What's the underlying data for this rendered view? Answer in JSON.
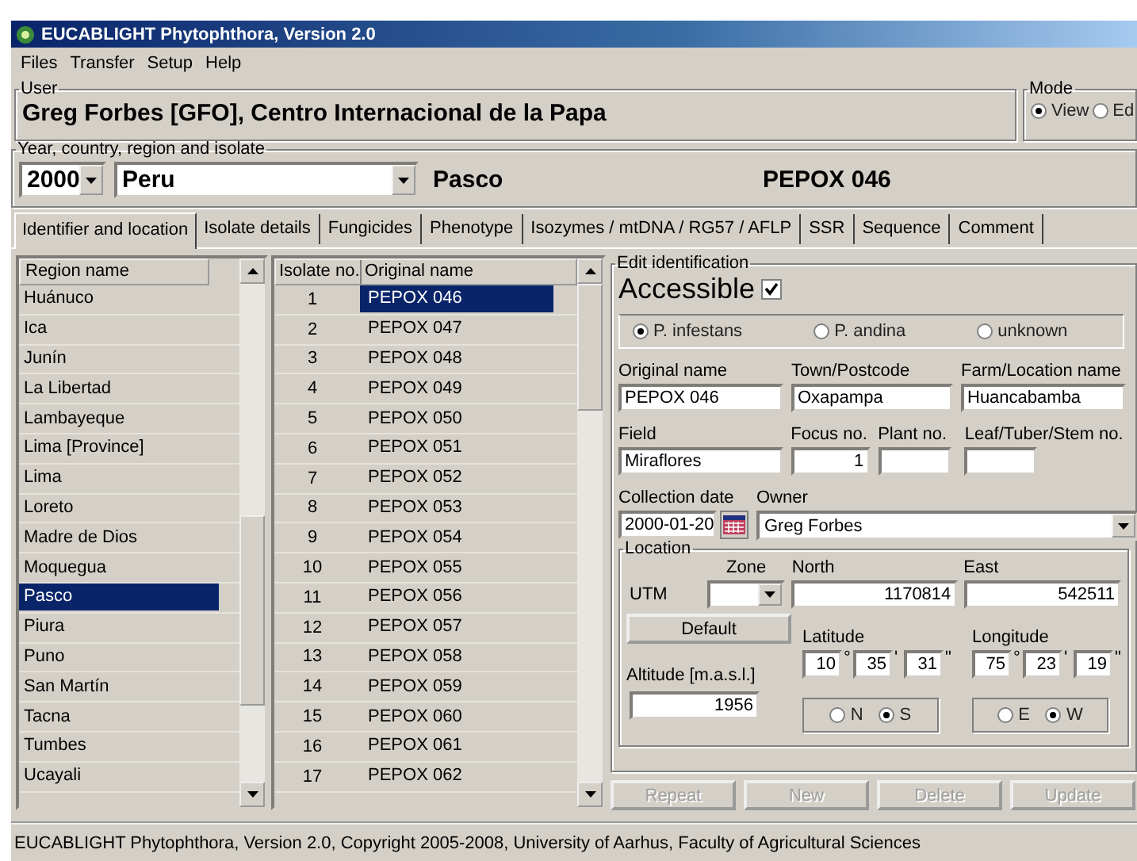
{
  "window": {
    "title": "EUCABLIGHT Phytophthora, Version 2.0"
  },
  "menu": [
    "Files",
    "Transfer",
    "Setup",
    "Help"
  ],
  "user": {
    "label": "User",
    "name": "Greg  Forbes [GFO], Centro Internacional de la Papa"
  },
  "mode": {
    "label": "Mode",
    "options": [
      {
        "label": "View",
        "selected": true
      },
      {
        "label": "Ed",
        "selected": false
      }
    ]
  },
  "selection": {
    "label": "Year, country, region and isolate",
    "year": "2000",
    "country": "Peru",
    "region": "Pasco",
    "isolate": "PEPOX 046"
  },
  "tabs": [
    {
      "label": "Identifier and location",
      "selected": true
    },
    {
      "label": "Isolate details",
      "selected": false
    },
    {
      "label": "Fungicides",
      "selected": false
    },
    {
      "label": "Phenotype",
      "selected": false
    },
    {
      "label": "Isozymes / mtDNA / RG57 / AFLP",
      "selected": false
    },
    {
      "label": "SSR",
      "selected": false
    },
    {
      "label": "Sequence",
      "selected": false
    },
    {
      "label": "Comment",
      "selected": false
    }
  ],
  "regions": {
    "column": "Region name",
    "items": [
      {
        "name": "Huánuco",
        "selected": false
      },
      {
        "name": "Ica",
        "selected": false
      },
      {
        "name": "Junín",
        "selected": false
      },
      {
        "name": "La Libertad",
        "selected": false
      },
      {
        "name": "Lambayeque",
        "selected": false
      },
      {
        "name": "Lima [Province]",
        "selected": false
      },
      {
        "name": "Lima",
        "selected": false
      },
      {
        "name": "Loreto",
        "selected": false
      },
      {
        "name": "Madre de Dios",
        "selected": false
      },
      {
        "name": "Moquegua",
        "selected": false
      },
      {
        "name": "Pasco",
        "selected": true
      },
      {
        "name": "Piura",
        "selected": false
      },
      {
        "name": "Puno",
        "selected": false
      },
      {
        "name": "San Martín",
        "selected": false
      },
      {
        "name": "Tacna",
        "selected": false
      },
      {
        "name": "Tumbes",
        "selected": false
      },
      {
        "name": "Ucayali",
        "selected": false
      }
    ]
  },
  "isolates": {
    "columns": [
      "Isolate no.",
      "Original name"
    ],
    "rows": [
      {
        "no": "1",
        "name": "PEPOX 046",
        "selected": true
      },
      {
        "no": "2",
        "name": "PEPOX 047",
        "selected": false
      },
      {
        "no": "3",
        "name": "PEPOX 048",
        "selected": false
      },
      {
        "no": "4",
        "name": "PEPOX 049",
        "selected": false
      },
      {
        "no": "5",
        "name": "PEPOX 050",
        "selected": false
      },
      {
        "no": "6",
        "name": "PEPOX 051",
        "selected": false
      },
      {
        "no": "7",
        "name": "PEPOX 052",
        "selected": false
      },
      {
        "no": "8",
        "name": "PEPOX 053",
        "selected": false
      },
      {
        "no": "9",
        "name": "PEPOX 054",
        "selected": false
      },
      {
        "no": "10",
        "name": "PEPOX 055",
        "selected": false
      },
      {
        "no": "11",
        "name": "PEPOX 056",
        "selected": false
      },
      {
        "no": "12",
        "name": "PEPOX 057",
        "selected": false
      },
      {
        "no": "13",
        "name": "PEPOX 058",
        "selected": false
      },
      {
        "no": "14",
        "name": "PEPOX 059",
        "selected": false
      },
      {
        "no": "15",
        "name": "PEPOX 060",
        "selected": false
      },
      {
        "no": "16",
        "name": "PEPOX 061",
        "selected": false
      },
      {
        "no": "17",
        "name": "PEPOX 062",
        "selected": false
      }
    ]
  },
  "edit": {
    "label": "Edit identification",
    "accessible": {
      "label": "Accessible",
      "checked": true
    },
    "species": [
      {
        "label": "P. infestans",
        "selected": true
      },
      {
        "label": "P. andina",
        "selected": false
      },
      {
        "label": "unknown",
        "selected": false
      }
    ],
    "original_name": {
      "label": "Original name",
      "value": "PEPOX 046"
    },
    "town": {
      "label": "Town/Postcode",
      "value": "Oxapampa"
    },
    "farm": {
      "label": "Farm/Location name",
      "value": "Huancabamba"
    },
    "field": {
      "label": "Field",
      "value": "Miraflores"
    },
    "focus": {
      "label": "Focus no.",
      "value": "1"
    },
    "plant": {
      "label": "Plant no."
    },
    "leaf": {
      "label": "Leaf/Tuber/Stem no."
    },
    "collection_date": {
      "label": "Collection date",
      "value": "2000-01-20"
    },
    "owner": {
      "label": "Owner",
      "value": "Greg Forbes"
    },
    "location": {
      "label": "Location",
      "utm_label": "UTM",
      "zone_label": "Zone",
      "north": {
        "label": "North",
        "value": "1170814"
      },
      "east": {
        "label": "East",
        "value": "542511"
      },
      "default_button": "Default",
      "latitude": {
        "label": "Latitude",
        "values": [
          "10",
          "35",
          "31"
        ],
        "units": [
          "°",
          "'",
          "\""
        ],
        "hemisphere": [
          {
            "label": "N",
            "selected": false
          },
          {
            "label": "S",
            "selected": true
          }
        ]
      },
      "longitude": {
        "label": "Longitude",
        "values": [
          "75",
          "23",
          "19"
        ],
        "units": [
          "°",
          "'",
          "\""
        ],
        "hemisphere": [
          {
            "label": "E",
            "selected": false
          },
          {
            "label": "W",
            "selected": true
          }
        ]
      },
      "altitude": {
        "label": "Altitude [m.a.s.l.]",
        "value": "1956"
      }
    }
  },
  "buttons": [
    {
      "label": "Repeat",
      "disabled": true
    },
    {
      "label": "New",
      "disabled": true
    },
    {
      "label": "Delete",
      "disabled": true
    },
    {
      "label": "Update",
      "disabled": true
    }
  ],
  "status_bar": "EUCABLIGHT Phytophthora, Version 2.0, Copyright 2005-2008, University of Aarhus, Faculty of Agricultural Sciences"
}
